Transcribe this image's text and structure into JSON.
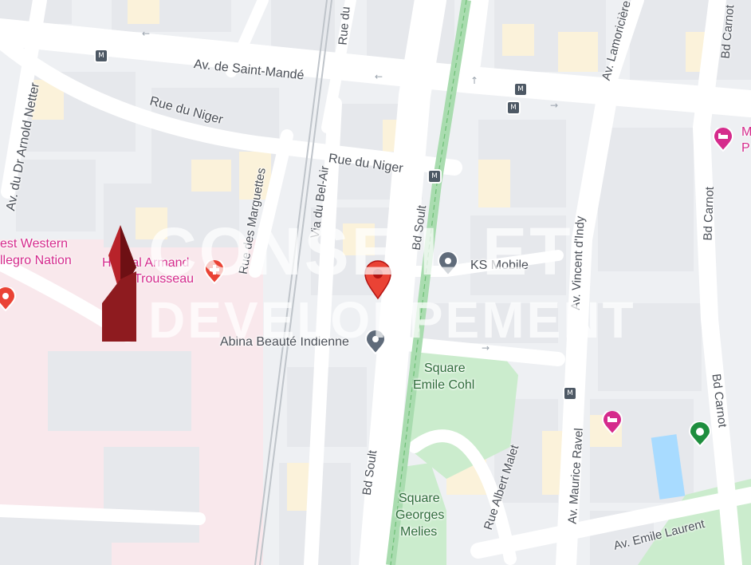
{
  "map": {
    "streets": {
      "av_saint_mande": "Av. de Saint-Mandé",
      "rue_du_niger_1": "Rue du Niger",
      "rue_du_niger_2": "Rue du Niger",
      "av_arnold_netter": "Av. du Dr Arnold Netter",
      "rue_marguettes": "Rue des Marguettes",
      "via_bel_air": "Via du Bel-Air",
      "bd_soult_top": "Bd Soult",
      "bd_soult_bottom": "Bd Soult",
      "av_vincent_dindy": "Av. Vincent d'Indy",
      "av_lamoriciere": "Av. Lamoricière",
      "rue_du": "Rue du",
      "bd_carnot_1": "Bd Carnot",
      "bd_carnot_2": "Bd Carnot",
      "bd_carnot_3": "Bd Carnot",
      "av_maurice_ravel": "Av. Maurice Ravel",
      "rue_albert_malet": "Rue Albert Malet",
      "av_emile_laurent": "Av. Emile Laurent"
    },
    "places": {
      "best_western_1": "est Western",
      "best_western_2": "llegro Nation",
      "hopital_1": "Hôpital Armand",
      "hopital_2": "Trousseau",
      "ks_mobile": "KS Mobile",
      "abina": "Abina Beauté Indienne",
      "square_cohl_1": "Square",
      "square_cohl_2": "Emile Cohl",
      "square_melies_1": "Square",
      "square_melies_2": "Georges",
      "square_melies_3": "Melies",
      "hotel_right_1": "M",
      "hotel_right_2": "P"
    },
    "watermark": {
      "line1": "CONSEIL ET",
      "line2": "DEVELOPPEMENT"
    },
    "colors": {
      "road": "#ffffff",
      "building": "#e8eaed",
      "block_yellow": "#fbf3dc",
      "park": "#cdeccf",
      "tram": "#a9dcaf",
      "hospital": "#f9e6ea",
      "water": "#aadaff",
      "poi_pink": "#d52b8c",
      "pin_red": "#ea4335",
      "logo_red": "#8e1b1f"
    },
    "icons": [
      "metro-icon",
      "hotel-icon",
      "hospital-icon",
      "location-pin-icon",
      "shop-icon",
      "park-icon"
    ]
  }
}
